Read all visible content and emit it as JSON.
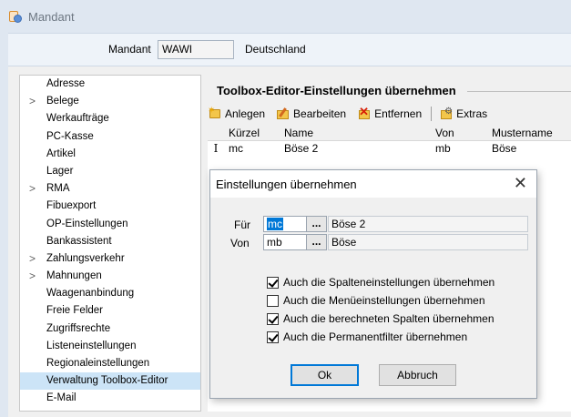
{
  "window": {
    "title": "Mandant"
  },
  "mandant": {
    "label": "Mandant",
    "value": "WAWI",
    "country": "Deutschland"
  },
  "nav": {
    "items": [
      {
        "label": "Adresse",
        "expandable": false
      },
      {
        "label": "Belege",
        "expandable": true
      },
      {
        "label": "Werkaufträge",
        "expandable": false
      },
      {
        "label": "PC-Kasse",
        "expandable": false
      },
      {
        "label": "Artikel",
        "expandable": false
      },
      {
        "label": "Lager",
        "expandable": false
      },
      {
        "label": "RMA",
        "expandable": true
      },
      {
        "label": "Fibuexport",
        "expandable": false
      },
      {
        "label": "OP-Einstellungen",
        "expandable": false
      },
      {
        "label": "Bankassistent",
        "expandable": false
      },
      {
        "label": "Zahlungsverkehr",
        "expandable": true
      },
      {
        "label": "Mahnungen",
        "expandable": true
      },
      {
        "label": "Waagenanbindung",
        "expandable": false
      },
      {
        "label": "Freie Felder",
        "expandable": false
      },
      {
        "label": "Zugriffsrechte",
        "expandable": false
      },
      {
        "label": "Listeneinstellungen",
        "expandable": false
      },
      {
        "label": "Regionaleinstellungen",
        "expandable": false
      },
      {
        "label": "Verwaltung Toolbox-Editor",
        "expandable": false,
        "selected": true
      },
      {
        "label": "E-Mail",
        "expandable": false
      }
    ],
    "chevron": ">"
  },
  "section": {
    "title": "Toolbox-Editor-Einstellungen übernehmen"
  },
  "toolbar": {
    "new_label": "Anlegen",
    "edit_label": "Bearbeiten",
    "delete_label": "Entfernen",
    "extras_label": "Extras"
  },
  "grid": {
    "columns": [
      "Kürzel",
      "Name",
      "Von",
      "Mustername"
    ],
    "rows": [
      {
        "indicator": "I",
        "kuerzel": "mc",
        "name": "Böse 2",
        "von": "mb",
        "mustername": "Böse"
      }
    ]
  },
  "dialog": {
    "title": "Einstellungen übernehmen",
    "close_glyph": "✕",
    "fuer_label": "Für",
    "fuer_code": "mc",
    "fuer_name": "Böse 2",
    "von_label": "Von",
    "von_code": "mb",
    "von_name": "Böse",
    "dots": "...",
    "checkboxes": [
      {
        "label": "Auch die Spalteneinstellungen übernehmen",
        "checked": true
      },
      {
        "label": "Auch die Menüeinstellungen übernehmen",
        "checked": false
      },
      {
        "label": "Auch die berechneten Spalten übernehmen",
        "checked": true
      },
      {
        "label": "Auch die Permanentfilter übernehmen",
        "checked": true
      }
    ],
    "ok_label": "Ok",
    "cancel_label": "Abbruch"
  }
}
